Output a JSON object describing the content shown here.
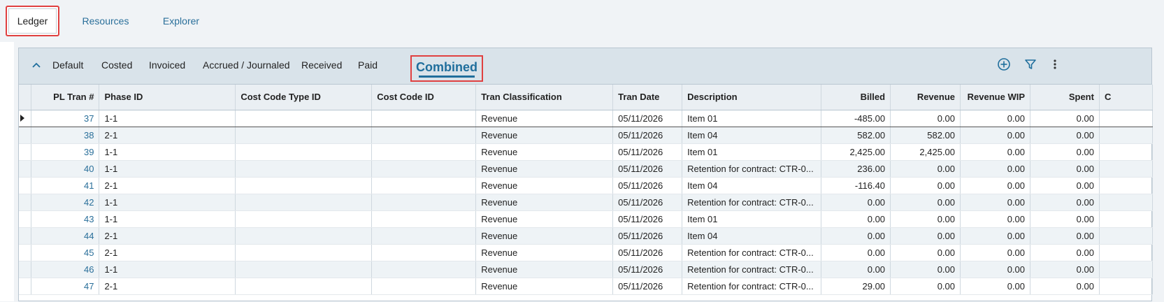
{
  "top_tabs": {
    "ledger": "Ledger",
    "resources": "Resources",
    "explorer": "Explorer"
  },
  "subtabs": {
    "default": "Default",
    "costed": "Costed",
    "invoiced": "Invoiced",
    "accrued": "Accrued / Journaled",
    "received": "Received",
    "paid": "Paid",
    "combined": "Combined"
  },
  "toolbar": {
    "add_icon": "plus-circle-icon",
    "filter_icon": "filter-icon",
    "more_icon": "more-vertical-icon"
  },
  "columns": {
    "pl_tran": "PL Tran #",
    "phase_id": "Phase ID",
    "cost_code_type_id": "Cost Code Type ID",
    "cost_code_id": "Cost Code ID",
    "tran_classification": "Tran Classification",
    "tran_date": "Tran Date",
    "description": "Description",
    "billed": "Billed",
    "revenue": "Revenue",
    "revenue_wip": "Revenue WIP",
    "spent": "Spent",
    "next": "C"
  },
  "rows": [
    {
      "pl_tran": "37",
      "phase_id": "1-1",
      "cost_code_type_id": "",
      "cost_code_id": "",
      "tran_classification": "Revenue",
      "tran_date": "05/11/2026",
      "description": "Item 01",
      "billed": "-485.00",
      "revenue": "0.00",
      "revenue_wip": "0.00",
      "spent": "0.00"
    },
    {
      "pl_tran": "38",
      "phase_id": "2-1",
      "cost_code_type_id": "",
      "cost_code_id": "",
      "tran_classification": "Revenue",
      "tran_date": "05/11/2026",
      "description": "Item 04",
      "billed": "582.00",
      "revenue": "582.00",
      "revenue_wip": "0.00",
      "spent": "0.00"
    },
    {
      "pl_tran": "39",
      "phase_id": "1-1",
      "cost_code_type_id": "",
      "cost_code_id": "",
      "tran_classification": "Revenue",
      "tran_date": "05/11/2026",
      "description": "Item 01",
      "billed": "2,425.00",
      "revenue": "2,425.00",
      "revenue_wip": "0.00",
      "spent": "0.00"
    },
    {
      "pl_tran": "40",
      "phase_id": "1-1",
      "cost_code_type_id": "",
      "cost_code_id": "",
      "tran_classification": "Revenue",
      "tran_date": "05/11/2026",
      "description": "Retention for contract: CTR-0...",
      "billed": "236.00",
      "revenue": "0.00",
      "revenue_wip": "0.00",
      "spent": "0.00"
    },
    {
      "pl_tran": "41",
      "phase_id": "2-1",
      "cost_code_type_id": "",
      "cost_code_id": "",
      "tran_classification": "Revenue",
      "tran_date": "05/11/2026",
      "description": "Item 04",
      "billed": "-116.40",
      "revenue": "0.00",
      "revenue_wip": "0.00",
      "spent": "0.00"
    },
    {
      "pl_tran": "42",
      "phase_id": "1-1",
      "cost_code_type_id": "",
      "cost_code_id": "",
      "tran_classification": "Revenue",
      "tran_date": "05/11/2026",
      "description": "Retention for contract: CTR-0...",
      "billed": "0.00",
      "revenue": "0.00",
      "revenue_wip": "0.00",
      "spent": "0.00"
    },
    {
      "pl_tran": "43",
      "phase_id": "1-1",
      "cost_code_type_id": "",
      "cost_code_id": "",
      "tran_classification": "Revenue",
      "tran_date": "05/11/2026",
      "description": "Item 01",
      "billed": "0.00",
      "revenue": "0.00",
      "revenue_wip": "0.00",
      "spent": "0.00"
    },
    {
      "pl_tran": "44",
      "phase_id": "2-1",
      "cost_code_type_id": "",
      "cost_code_id": "",
      "tran_classification": "Revenue",
      "tran_date": "05/11/2026",
      "description": "Item 04",
      "billed": "0.00",
      "revenue": "0.00",
      "revenue_wip": "0.00",
      "spent": "0.00"
    },
    {
      "pl_tran": "45",
      "phase_id": "2-1",
      "cost_code_type_id": "",
      "cost_code_id": "",
      "tran_classification": "Revenue",
      "tran_date": "05/11/2026",
      "description": "Retention for contract: CTR-0...",
      "billed": "0.00",
      "revenue": "0.00",
      "revenue_wip": "0.00",
      "spent": "0.00"
    },
    {
      "pl_tran": "46",
      "phase_id": "1-1",
      "cost_code_type_id": "",
      "cost_code_id": "",
      "tran_classification": "Revenue",
      "tran_date": "05/11/2026",
      "description": "Retention for contract: CTR-0...",
      "billed": "0.00",
      "revenue": "0.00",
      "revenue_wip": "0.00",
      "spent": "0.00"
    },
    {
      "pl_tran": "47",
      "phase_id": "2-1",
      "cost_code_type_id": "",
      "cost_code_id": "",
      "tran_classification": "Revenue",
      "tran_date": "05/11/2026",
      "description": "Retention for contract: CTR-0...",
      "billed": "29.00",
      "revenue": "0.00",
      "revenue_wip": "0.00",
      "spent": "0.00"
    }
  ],
  "colors": {
    "accent": "#1f6e9c",
    "link": "#2a6f9a",
    "highlight_border": "#e04040"
  }
}
